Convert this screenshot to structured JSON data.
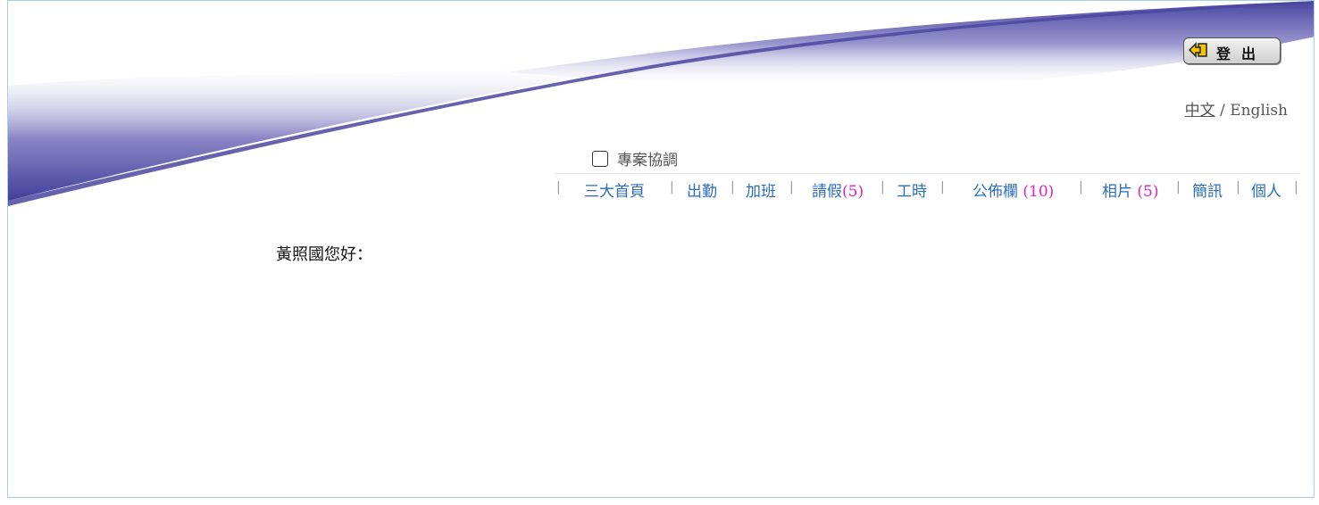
{
  "header": {
    "logout_label": "登出",
    "lang_zh": "中文",
    "lang_sep": " / ",
    "lang_en": "English"
  },
  "project": {
    "label": "專案協調",
    "checked": false
  },
  "nav": {
    "items": [
      {
        "label": "三大首頁",
        "count": ""
      },
      {
        "label": "出勤",
        "count": ""
      },
      {
        "label": "加班",
        "count": ""
      },
      {
        "label": "請假",
        "count": "(5)"
      },
      {
        "label": "工時",
        "count": ""
      },
      {
        "label": "公佈欄 ",
        "count": "(10)"
      },
      {
        "label": "相片 ",
        "count": "(5)"
      },
      {
        "label": "簡訊",
        "count": ""
      },
      {
        "label": "個人",
        "count": ""
      }
    ],
    "separator": "|"
  },
  "main": {
    "greeting": "黃照國您好："
  },
  "colors": {
    "swoosh": "#4b47a0",
    "link": "#2a6ebb",
    "count": "#e020c0",
    "border": "#a9cfe6"
  }
}
